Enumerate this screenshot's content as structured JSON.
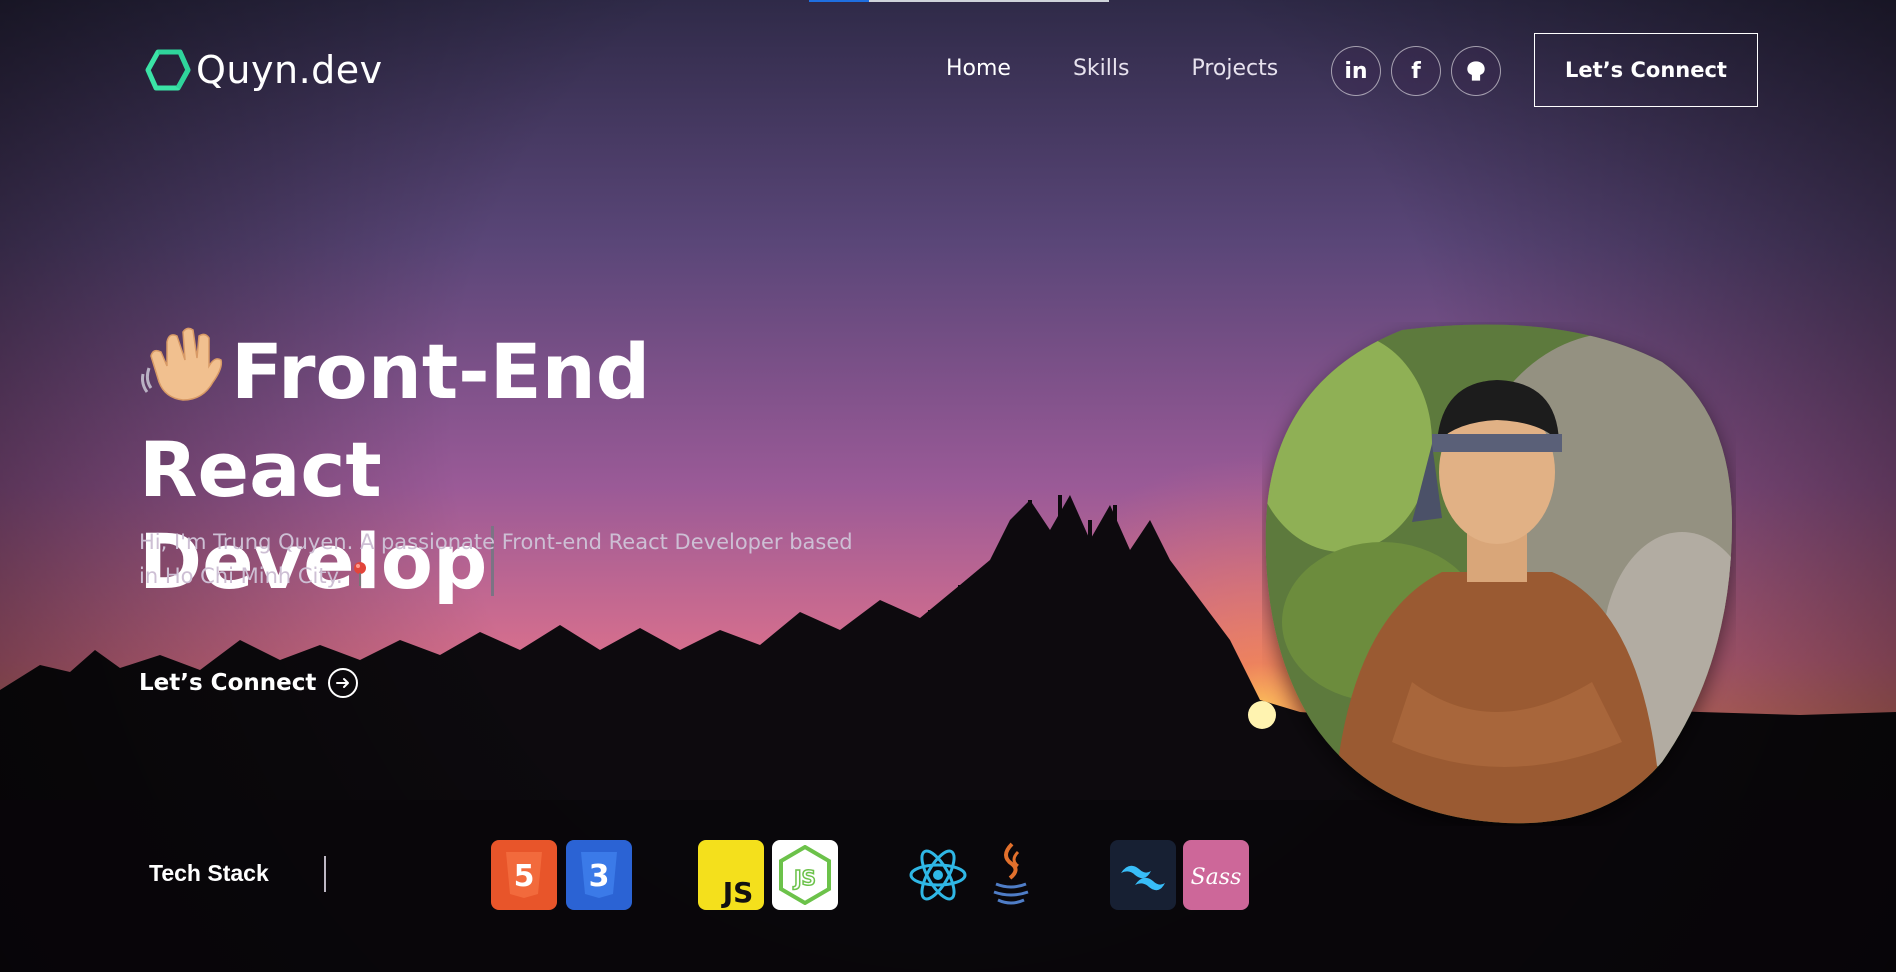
{
  "nav": {
    "logo_text": "Quyn.dev",
    "links": [
      "Home",
      "Skills",
      "Projects"
    ],
    "social_icons": [
      "linkedin-icon",
      "facebook-icon",
      "github-icon"
    ],
    "connect_label": "Let’s Connect"
  },
  "hero": {
    "title_line1": "Front-End React",
    "title_line2": "Develop",
    "subtitle": "Hi, I'm Trung Quyen. A passionate Front-end React Developer based in Ho Chi Minh City.",
    "cta_label": "Let’s Connect"
  },
  "tech_stack": {
    "label": "Tech Stack",
    "icons": [
      {
        "name": "html5-icon",
        "text": "5",
        "color": "#e8552a"
      },
      {
        "name": "css3-icon",
        "text": "3",
        "color": "#2b63d4"
      },
      {
        "name": "javascript-icon",
        "text": "JS",
        "color": "#f4e01c"
      },
      {
        "name": "nodejs-icon",
        "text": "JS",
        "color": "#ffffff"
      },
      {
        "name": "react-icon",
        "text": "",
        "color": "#2fb7e6"
      },
      {
        "name": "java-icon",
        "text": "",
        "color": "#e2702c"
      },
      {
        "name": "tailwind-icon",
        "text": "",
        "color": "#0f172a"
      },
      {
        "name": "sass-icon",
        "text": "Sass",
        "color": "#cd6799"
      }
    ]
  },
  "colors": {
    "sky_top": "#3a3358",
    "sky_mid": "#a05a9a",
    "sky_horizon": "#e67a86",
    "sun": "#ffc233",
    "accent_green": "#3be3a6"
  }
}
